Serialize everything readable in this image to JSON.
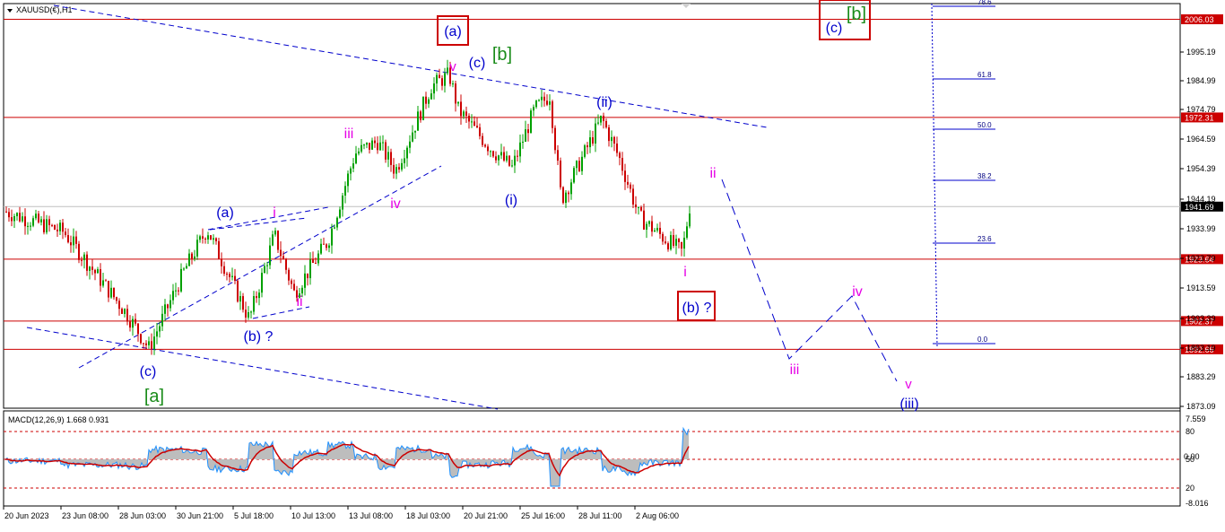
{
  "symbol_label": "XAUUSD(€),H1",
  "macd_label": "MACD(12,26,9) 1.668 0.931",
  "price_axis": {
    "min": 1873.09,
    "max": 2006.03,
    "ticks": [
      "1995.19",
      "1984.99",
      "1974.79",
      "1964.59",
      "1954.39",
      "1944.19",
      "1933.99",
      "1923.79",
      "1913.59",
      "1903.39",
      "1893.19",
      "1883.29",
      "1873.09"
    ]
  },
  "macd_axis": {
    "ticks": [
      "7.559",
      "80",
      "50",
      "20",
      "-8.016"
    ],
    "overlap_tick": "0.00"
  },
  "time_axis": {
    "labels": [
      "20 Jun 2023",
      "23 Jun 08:00",
      "28 Jun 03:00",
      "30 Jun 21:00",
      "5 Jul 18:00",
      "10 Jul 13:00",
      "13 Jul 08:00",
      "18 Jul 03:00",
      "20 Jul 21:00",
      "25 Jul 16:00",
      "28 Jul 11:00",
      "2 Aug 06:00"
    ]
  },
  "levels": [
    {
      "price": 2006.03,
      "label": "2006.03",
      "color": "#cc0000"
    },
    {
      "price": 1972.31,
      "label": "1972.31",
      "color": "#cc0000"
    },
    {
      "price": 1941.69,
      "label": "1941.69",
      "color": "#000000"
    },
    {
      "price": 1923.64,
      "label": "1923.64",
      "color": "#cc0000"
    },
    {
      "price": 1902.37,
      "label": "1902.37",
      "color": "#cc0000"
    },
    {
      "price": 1892.66,
      "label": "1892.66",
      "color": "#cc0000"
    }
  ],
  "fib_levels": [
    "78.6",
    "61.8",
    "50.0",
    "38.2",
    "23.6",
    "0.0"
  ],
  "wave_labels": {
    "a_bracket_bottom": "[a]",
    "c_bottom": "(c)",
    "b_question_left": "(b) ?",
    "a_paren_left": "(a)",
    "i_left": "i",
    "ii_left": "ii",
    "iii_left": "iii",
    "iv_left": "iv",
    "v_top": "v",
    "c_top": "(c)",
    "b_bracket_top": "[b]",
    "a_boxed_top": "(a)",
    "i_paren": "(i)",
    "ii_paren": "(ii)",
    "ii_proj": "ii",
    "i_proj": "i",
    "b_question_boxed": "(b) ?",
    "iii_proj": "iii",
    "iv_proj": "iv",
    "v_proj": "v",
    "iii_paren_proj": "(iii)",
    "c_boxed_right": "(c)",
    "b_bracket_right": "[b]"
  },
  "colors": {
    "bull_candle": "#00a000",
    "bear_candle": "#cc0000",
    "level_line": "#cc0000",
    "trend_line": "#0000cc",
    "wave_blue": "#0000cc",
    "wave_magenta": "#e600e6",
    "wave_green": "#1a8c1a",
    "macd_line": "#1e90ff",
    "macd_signal": "#cc0000",
    "macd_hist": "#bdbdbd"
  },
  "chart_data": {
    "type": "candlestick",
    "symbol": "XAUUSD(€)",
    "timeframe": "H1",
    "y_range": [
      1873.09,
      2006.03
    ],
    "key_price_path": [
      {
        "time": "20 Jun 2023",
        "price": 1940
      },
      {
        "time": "23 Jun 08:00",
        "price": 1933
      },
      {
        "time": "28 Jun 03:00",
        "price": 1905
      },
      {
        "time": "28 Jun 18:00",
        "price": 1893
      },
      {
        "time": "30 Jun 21:00",
        "price": 1920
      },
      {
        "time": "4 Jul 00:00",
        "price": 1934
      },
      {
        "time": "5 Jul 18:00",
        "price": 1903
      },
      {
        "time": "7 Jul 00:00",
        "price": 1932
      },
      {
        "time": "7 Jul 14:00",
        "price": 1912
      },
      {
        "time": "10 Jul 13:00",
        "price": 1930
      },
      {
        "time": "12 Jul 00:00",
        "price": 1960
      },
      {
        "time": "13 Jul 08:00",
        "price": 1964
      },
      {
        "time": "14 Jul 00:00",
        "price": 1954
      },
      {
        "time": "17 Jul 00:00",
        "price": 1983
      },
      {
        "time": "18 Jul 03:00",
        "price": 1987
      },
      {
        "time": "19 Jul 00:00",
        "price": 1975
      },
      {
        "time": "20 Jul 21:00",
        "price": 1962
      },
      {
        "time": "24 Jul 00:00",
        "price": 1955
      },
      {
        "time": "25 Jul 16:00",
        "price": 1975
      },
      {
        "time": "26 Jul 00:00",
        "price": 1980
      },
      {
        "time": "27 Jul 00:00",
        "price": 1944
      },
      {
        "time": "28 Jul 11:00",
        "price": 1972
      },
      {
        "time": "31 Jul 00:00",
        "price": 1958
      },
      {
        "time": "1 Aug 00:00",
        "price": 1938
      },
      {
        "time": "2 Aug 06:00",
        "price": 1932
      },
      {
        "time": "3 Aug 00:00",
        "price": 1926
      },
      {
        "time": "3 Aug 12:00",
        "price": 1941.69
      }
    ],
    "macd": {
      "main": 1.668,
      "signal": 0.931,
      "params": "12,26,9",
      "y_range": [
        -8.016,
        7.559
      ]
    }
  }
}
